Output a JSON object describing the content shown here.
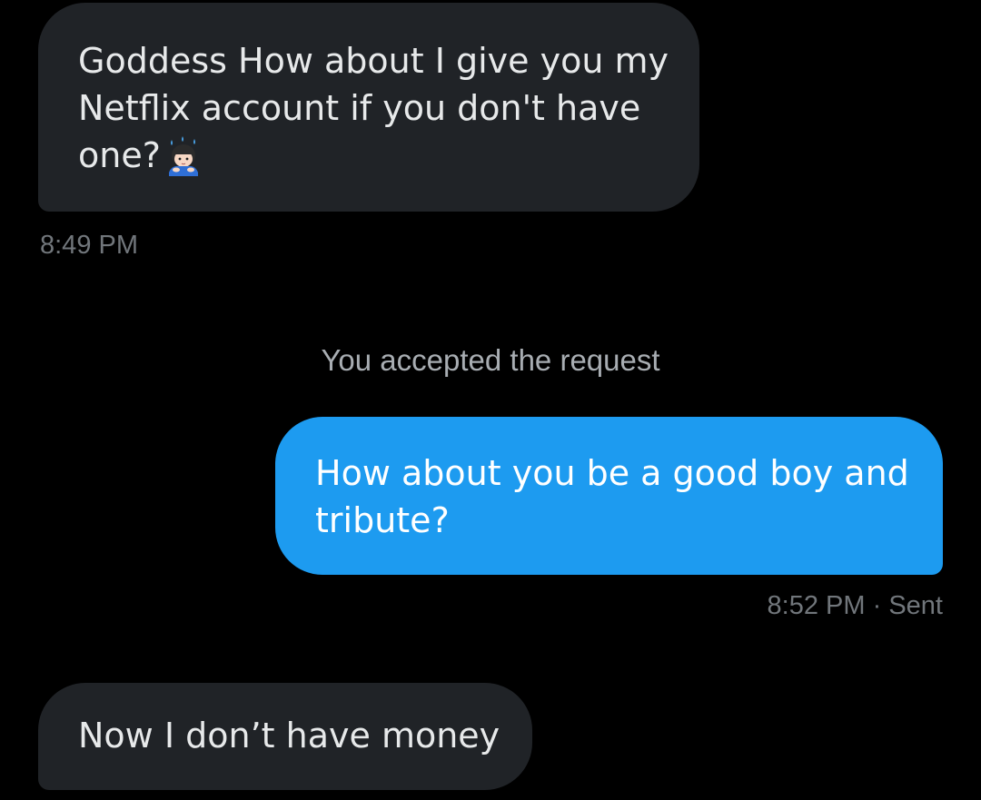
{
  "conversation": {
    "messages": [
      {
        "direction": "received",
        "lines": [
          "Goddess How about I give you my",
          "Netflix account if you don't have",
          "one?"
        ],
        "emoji": "bowing-boy-sweat-emoji",
        "timestamp": "8:49 PM"
      },
      {
        "direction": "sent",
        "lines": [
          "How about you be a good boy and",
          "tribute?"
        ],
        "timestamp": "8:52 PM",
        "separator": "·",
        "status": "Sent"
      },
      {
        "direction": "received",
        "lines": [
          "Now I don’t have money"
        ]
      }
    ],
    "system_note": "You accepted the request"
  },
  "colors": {
    "background": "#000000",
    "received_bubble": "#202327",
    "sent_bubble": "#1d9bf0",
    "text_primary": "#e7e9ea",
    "text_muted": "#71767b"
  }
}
